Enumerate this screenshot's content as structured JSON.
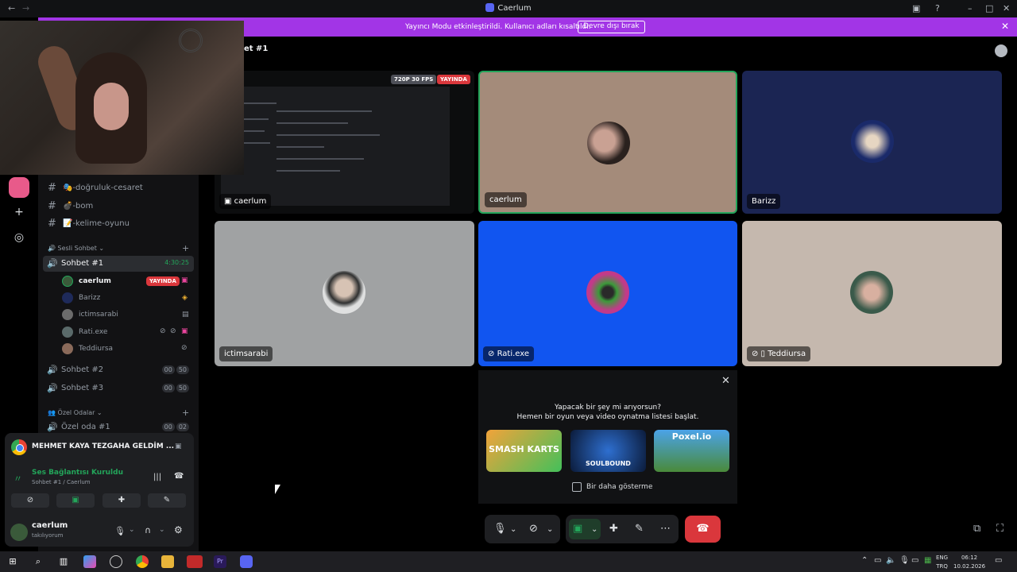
{
  "window": {
    "title": "Caerlum"
  },
  "banner": {
    "text": "Yayıncı Modu etkinleştirildi. Kullanıcı adları kısaltıldı.",
    "button": "Devre dışı bırak"
  },
  "stage": {
    "title": "et #1"
  },
  "channels": {
    "text": [
      {
        "name": "🎭-doğruluk-cesaret"
      },
      {
        "name": "💣-bom"
      },
      {
        "name": "📝-kelime-oyunu"
      }
    ],
    "voice_category": "Sesli Sohbet",
    "voice": [
      {
        "name": "Sohbet #1",
        "count": "4:30:25"
      },
      {
        "name": "Sohbet #2",
        "count_a": "00",
        "count_b": "50"
      },
      {
        "name": "Sohbet #3",
        "count_a": "00",
        "count_b": "50"
      }
    ],
    "private_category": "Özel Odalar",
    "private": [
      {
        "name": "Özel oda #1",
        "count_a": "00",
        "count_b": "02"
      }
    ]
  },
  "members": [
    {
      "name": "caerlum",
      "live": "YAYINDA"
    },
    {
      "name": "Barizz"
    },
    {
      "name": "ictimsarabi"
    },
    {
      "name": "Rati.exe"
    },
    {
      "name": "Teddiursa"
    }
  ],
  "activity": {
    "now_playing": "MEHMET KAYA TEZGAHA GELDİM ..."
  },
  "connection": {
    "status": "Ses Bağlantısı Kuruldu",
    "channel": "Sohbet #1 / Caerlum"
  },
  "user": {
    "name": "caerlum",
    "status": "takılıyorum"
  },
  "tiles": [
    {
      "name": "caerlum",
      "quality": "720P 30 FPS",
      "live": "YAYINDA"
    },
    {
      "name": "caerlum"
    },
    {
      "name": "Barizz"
    },
    {
      "name": "ictimsarabi"
    },
    {
      "name": "Rati.exe"
    },
    {
      "name": "Teddiursa"
    }
  ],
  "popup": {
    "line1": "Yapacak bir şey mi arıyorsun?",
    "line2": "Hemen bir oyun veya video oynatma listesi başlat.",
    "games": [
      "SMASH KARTS",
      "SOULBOUND",
      "Poxel.io"
    ],
    "checkbox": "Bir daha gösterme"
  },
  "taskbar": {
    "lang_1": "ENG",
    "lang_2": "TRQ",
    "time": "06:12",
    "date": "10.02.2026"
  },
  "colors": {
    "accent": "#5865f2",
    "banner": "#a235e6",
    "live": "#da373c",
    "connected": "#23a55a"
  }
}
